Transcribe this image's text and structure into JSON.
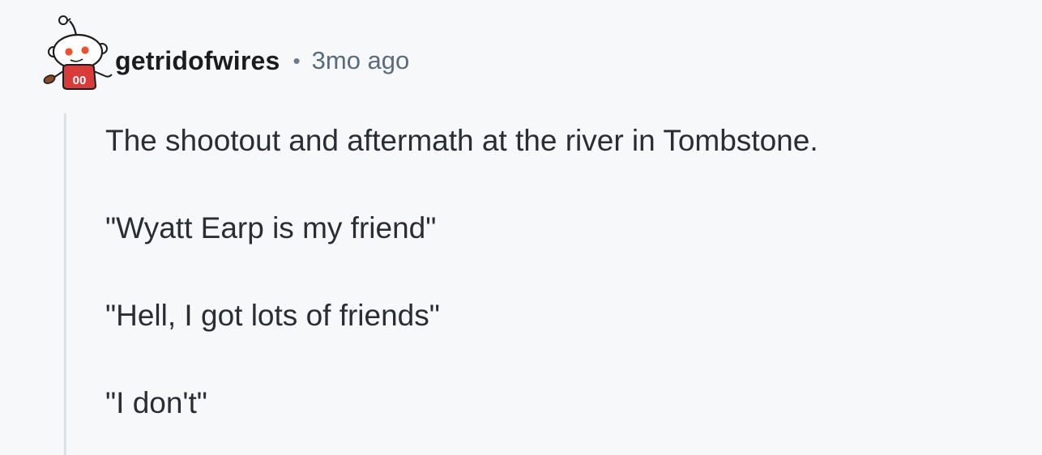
{
  "comment": {
    "author": "getridofwires",
    "separator": "•",
    "timestamp": "3mo ago",
    "avatar_icon": "snoo-avatar-icon",
    "jersey_number": "00",
    "paragraphs": [
      "The shootout and aftermath at the river in Tombstone.",
      "\"Wyatt Earp is my friend\"",
      "\"Hell, I got lots of friends\"",
      "\"I don't\""
    ]
  },
  "colors": {
    "background": "#f7f8fa",
    "username": "#1c1c1c",
    "timestamp": "#5a6b7e",
    "body_text": "#2a2d31",
    "thread_line": "#dbe1e8",
    "avatar_accent": "#d93a3a"
  }
}
